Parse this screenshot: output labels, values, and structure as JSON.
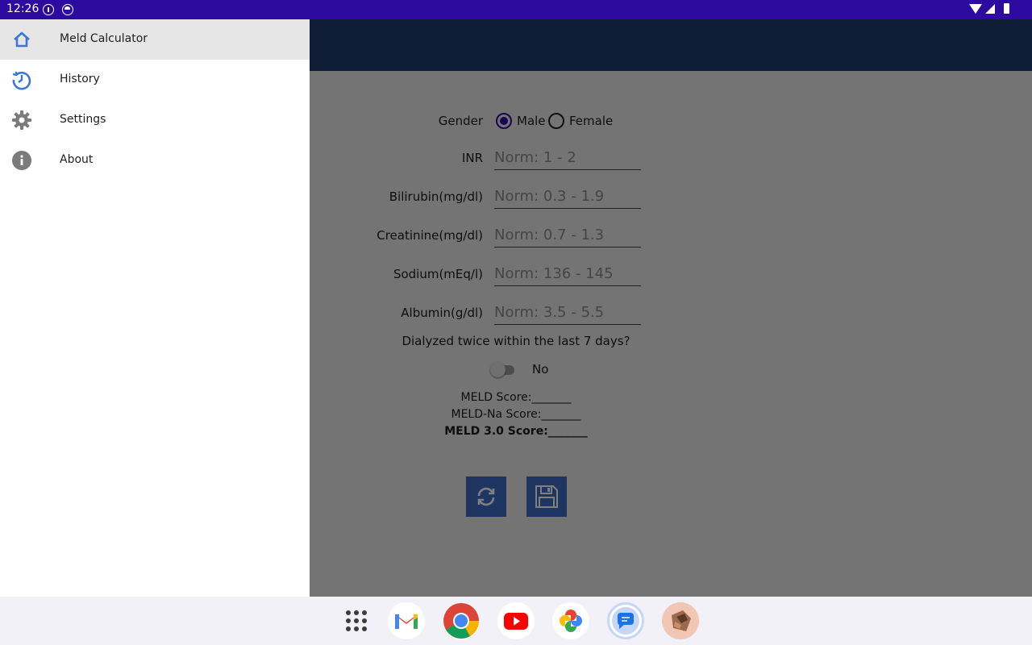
{
  "status_bar": {
    "time": "12:26"
  },
  "drawer": {
    "items": [
      {
        "label": "Meld Calculator",
        "icon": "home-icon",
        "selected": true
      },
      {
        "label": "History",
        "icon": "history-icon",
        "selected": false
      },
      {
        "label": "Settings",
        "icon": "gear-icon",
        "selected": false
      },
      {
        "label": "About",
        "icon": "info-icon",
        "selected": false
      }
    ]
  },
  "form": {
    "gender_label": "Gender",
    "gender_options": [
      "Male",
      "Female"
    ],
    "gender_selected": "Male",
    "inr_label": "INR",
    "inr_placeholder": "Norm: 1 - 2",
    "bilirubin_label": "Bilirubin(mg/dl)",
    "bilirubin_placeholder": "Norm: 0.3 - 1.9",
    "creatinine_label": "Creatinine(mg/dl)",
    "creatinine_placeholder": "Norm: 0.7 - 1.3",
    "sodium_label": "Sodium(mEq/l)",
    "sodium_placeholder": "Norm: 136 - 145",
    "albumin_label": "Albumin(g/dl)",
    "albumin_placeholder": "Norm: 3.5 - 5.5",
    "dialysis_question": "Dialyzed twice within the last 7 days?",
    "dialysis_state": "No"
  },
  "scores": {
    "meld": "MELD Score:_______",
    "meld_na": "MELD-Na Score:_______",
    "meld_3": "MELD 3.0 Score:_______"
  },
  "actions": {
    "refresh_icon": "refresh-icon",
    "save_icon": "save-icon"
  },
  "taskbar": {
    "apps": [
      "app-drawer-icon",
      "gmail-icon",
      "chrome-icon",
      "youtube-icon",
      "photos-icon",
      "messages-icon",
      "avatar-icon"
    ]
  },
  "colors": {
    "status_bar": "#2d0aa0",
    "app_bar": "#1e3a6e",
    "accent": "#3d6bc4",
    "drawer_selected": "#e6e6e6"
  }
}
